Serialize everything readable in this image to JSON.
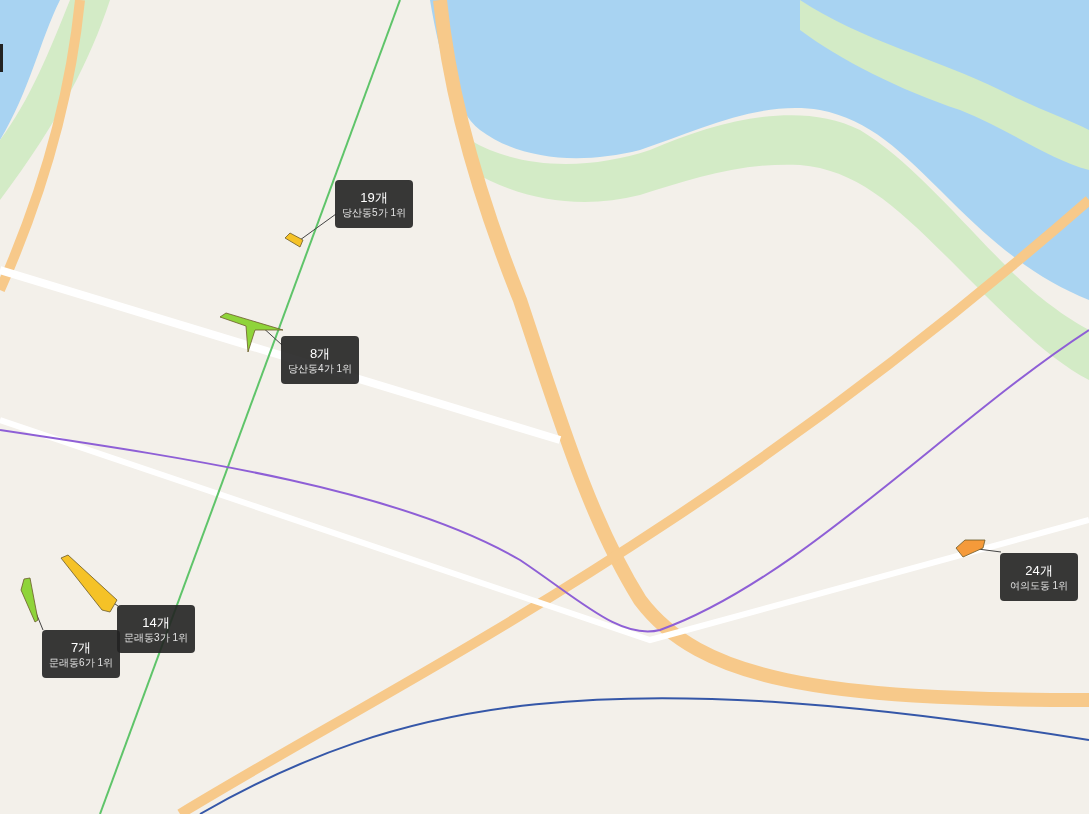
{
  "map_markers": [
    {
      "count": "19개",
      "rank": "당산동5가 1위",
      "color": "#f5c227"
    },
    {
      "count": "8개",
      "rank": "당산동4가 1위",
      "color": "#8fd43a"
    },
    {
      "count": "14개",
      "rank": "문래동3가 1위",
      "color": "#f5c227"
    },
    {
      "count": "7개",
      "rank": "문래동6가 1위",
      "color": "#8fd43a"
    },
    {
      "count": "24개",
      "rank": "여의도동 1위",
      "color": "#f59a3a"
    }
  ]
}
